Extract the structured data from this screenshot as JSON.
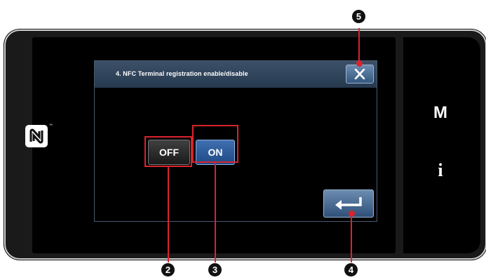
{
  "dialog": {
    "title": "4.   NFC Terminal registration enable/disable",
    "off_label": "OFF",
    "on_label": "ON"
  },
  "side_panel": {
    "mode_key": "M",
    "info_key": "i"
  },
  "nfc_mark": {
    "tm": "™"
  },
  "callouts": {
    "c2": "2",
    "c3": "3",
    "c4": "4",
    "c5": "5"
  },
  "colors": {
    "callout": "#d9232e",
    "titlebar": "#2f4560",
    "on_button": "#2d5d9c"
  }
}
